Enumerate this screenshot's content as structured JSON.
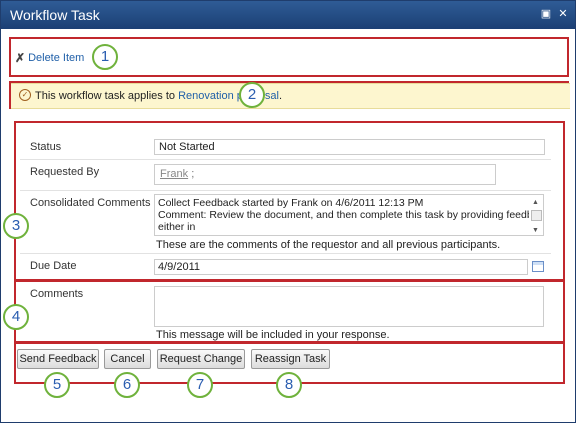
{
  "window": {
    "title": "Workflow Task",
    "maximize_icon": "maximize-icon",
    "close_icon": "close-icon"
  },
  "toolbar": {
    "delete_label": "Delete Item"
  },
  "notice": {
    "prefix": "This workflow task applies to ",
    "link": "Renovation proposal",
    "suffix": "."
  },
  "form": {
    "status": {
      "label": "Status",
      "value": "Not Started"
    },
    "requested_by": {
      "label": "Requested By",
      "value": "Frank",
      "separator": ";"
    },
    "consolidated": {
      "label": "Consolidated Comments",
      "line1": "Collect Feedback started by Frank on 4/6/2011 12:13 PM",
      "line2": "Comment: Review the document, and then complete this task by providing feedback",
      "line3": "either in",
      "hint": "These are the comments of the requestor and all previous participants."
    },
    "due_date": {
      "label": "Due Date",
      "value": "4/9/2011"
    },
    "comments": {
      "label": "Comments",
      "value": "",
      "hint": "This message will be included in your response."
    }
  },
  "buttons": {
    "send_feedback": "Send Feedback",
    "cancel": "Cancel",
    "request_change": "Request Change",
    "reassign_task": "Reassign Task"
  },
  "callouts": [
    "1",
    "2",
    "3",
    "4",
    "5",
    "6",
    "7",
    "8"
  ],
  "colors": {
    "title_bar": "#234a82",
    "callout_border": "#6fb23c",
    "highlight_box": "#c1272d",
    "link": "#1f5fa8"
  }
}
